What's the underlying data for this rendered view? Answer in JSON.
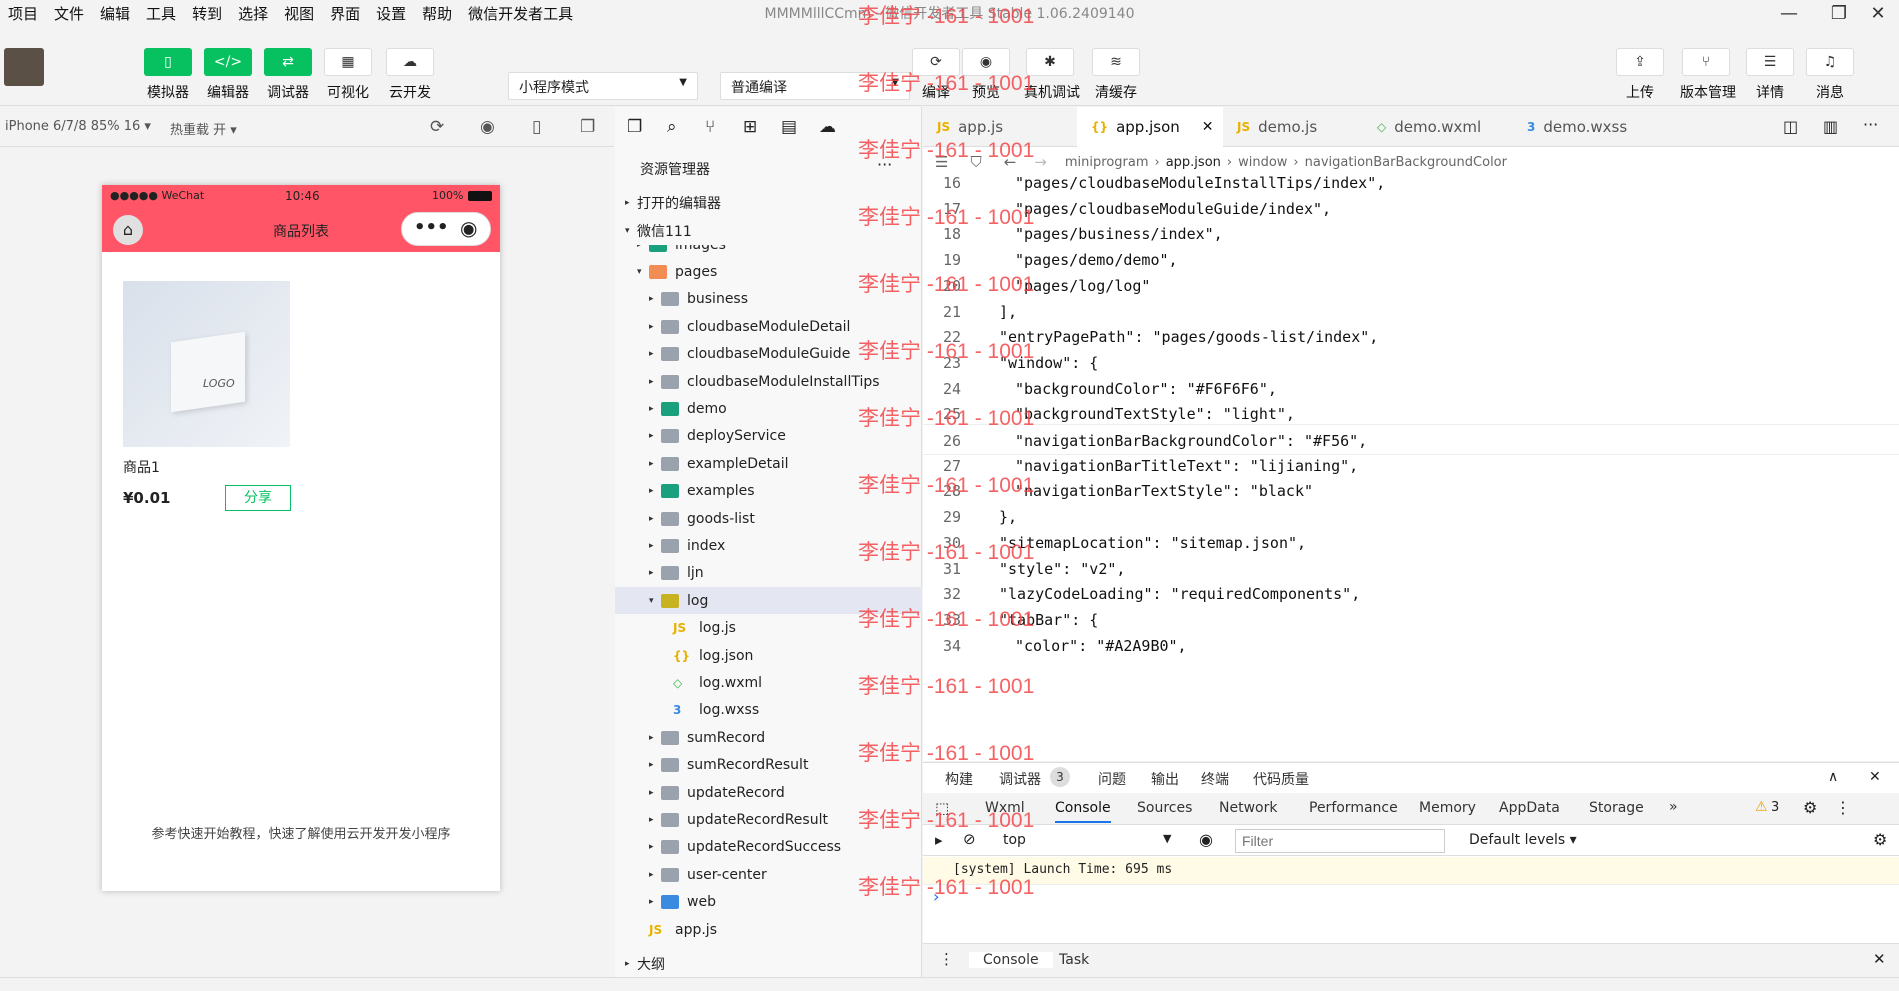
{
  "menu": [
    "项目",
    "文件",
    "编辑",
    "工具",
    "转到",
    "选择",
    "视图",
    "界面",
    "设置",
    "帮助",
    "微信开发者工具"
  ],
  "window_title": "MMMMlllCCmm - 微信开发者工具 Stable 1.06.2409140",
  "toolbar": {
    "left_buttons": [
      "模拟器",
      "编辑器",
      "调试器",
      "可视化",
      "云开发"
    ],
    "mode_select": "小程序模式",
    "compile_select": "普通编译",
    "mid_buttons": [
      "编译",
      "预览",
      "真机调试",
      "清缓存"
    ],
    "right_buttons": [
      "上传",
      "版本管理",
      "详情",
      "消息"
    ]
  },
  "watermark": "李佳宁 -161 - 1001",
  "simbar": {
    "device": "iPhone 6/7/8 85% 16 ▾",
    "hotreload": "热重载 开 ▾"
  },
  "phone": {
    "carrier": "●●●●● WeChat",
    "time": "10:46",
    "battery": "100%",
    "title": "商品列表",
    "product_name": "商品1",
    "price": "¥0.01",
    "share": "分享",
    "footer": "参考快速开始教程，快速了解使用云开发开发小程序",
    "logo_text": "LOGO"
  },
  "explorer": {
    "title": "资源管理器",
    "open_editors": "打开的编辑器",
    "project": "微信111",
    "items": [
      {
        "name": "images",
        "depth": 1,
        "kind": "teal",
        "arrow": "▸"
      },
      {
        "name": "pages",
        "depth": 1,
        "kind": "orange",
        "arrow": "▾"
      },
      {
        "name": "business",
        "depth": 2,
        "kind": "grey",
        "arrow": "▸"
      },
      {
        "name": "cloudbaseModuleDetail",
        "depth": 2,
        "kind": "grey",
        "arrow": "▸"
      },
      {
        "name": "cloudbaseModuleGuide",
        "depth": 2,
        "kind": "grey",
        "arrow": "▸"
      },
      {
        "name": "cloudbaseModuleInstallTips",
        "depth": 2,
        "kind": "grey",
        "arrow": "▸"
      },
      {
        "name": "demo",
        "depth": 2,
        "kind": "teal",
        "arrow": "▸"
      },
      {
        "name": "deployService",
        "depth": 2,
        "kind": "grey",
        "arrow": "▸"
      },
      {
        "name": "exampleDetail",
        "depth": 2,
        "kind": "grey",
        "arrow": "▸"
      },
      {
        "name": "examples",
        "depth": 2,
        "kind": "teal",
        "arrow": "▸"
      },
      {
        "name": "goods-list",
        "depth": 2,
        "kind": "grey",
        "arrow": "▸"
      },
      {
        "name": "index",
        "depth": 2,
        "kind": "grey",
        "arrow": "▸"
      },
      {
        "name": "ljn",
        "depth": 2,
        "kind": "grey",
        "arrow": "▸"
      },
      {
        "name": "log",
        "depth": 2,
        "kind": "lime",
        "arrow": "▾"
      },
      {
        "name": "log.js",
        "depth": 3,
        "kind": "js",
        "arrow": ""
      },
      {
        "name": "log.json",
        "depth": 3,
        "kind": "json",
        "arrow": ""
      },
      {
        "name": "log.wxml",
        "depth": 3,
        "kind": "wxml",
        "arrow": ""
      },
      {
        "name": "log.wxss",
        "depth": 3,
        "kind": "wxss",
        "arrow": ""
      },
      {
        "name": "sumRecord",
        "depth": 2,
        "kind": "grey",
        "arrow": "▸"
      },
      {
        "name": "sumRecordResult",
        "depth": 2,
        "kind": "grey",
        "arrow": "▸"
      },
      {
        "name": "updateRecord",
        "depth": 2,
        "kind": "grey",
        "arrow": "▸"
      },
      {
        "name": "updateRecordResult",
        "depth": 2,
        "kind": "grey",
        "arrow": "▸"
      },
      {
        "name": "updateRecordSuccess",
        "depth": 2,
        "kind": "grey",
        "arrow": "▸"
      },
      {
        "name": "user-center",
        "depth": 2,
        "kind": "grey",
        "arrow": "▸"
      },
      {
        "name": "web",
        "depth": 2,
        "kind": "blue",
        "arrow": "▸"
      },
      {
        "name": "app.js",
        "depth": 1,
        "kind": "js",
        "arrow": ""
      }
    ],
    "outline": "大纲"
  },
  "editor": {
    "tabs": [
      "app.js",
      "app.json",
      "demo.js",
      "demo.wxml",
      "demo.wxss"
    ],
    "active_tab": "app.json",
    "breadcrumb": [
      "miniprogram",
      "app.json",
      "window",
      "navigationBarBackgroundColor"
    ],
    "lines": [
      {
        "no": "16",
        "text": "\"pages/cloudbaseModuleInstallTips/index\","
      },
      {
        "no": "17",
        "text": "\"pages/cloudbaseModuleGuide/index\","
      },
      {
        "no": "18",
        "text": "\"pages/business/index\","
      },
      {
        "no": "19",
        "text": "\"pages/demo/demo\","
      },
      {
        "no": "20",
        "text": "\"pages/log/log\""
      },
      {
        "no": "21",
        "text": "],"
      },
      {
        "no": "22",
        "text": "\"entryPagePath\": \"pages/goods-list/index\","
      },
      {
        "no": "23",
        "text": "\"window\": {"
      },
      {
        "no": "24",
        "text": "\"backgroundColor\": \"#F6F6F6\","
      },
      {
        "no": "25",
        "text": "\"backgroundTextStyle\": \"light\","
      },
      {
        "no": "26",
        "text": "\"navigationBarBackgroundColor\": \"#F56\","
      },
      {
        "no": "27",
        "text": "\"navigationBarTitleText\": \"lijianing\","
      },
      {
        "no": "28",
        "text": "\"navigationBarTextStyle\": \"black\""
      },
      {
        "no": "29",
        "text": "},"
      },
      {
        "no": "30",
        "text": "\"sitemapLocation\": \"sitemap.json\","
      },
      {
        "no": "31",
        "text": "\"style\": \"v2\","
      },
      {
        "no": "32",
        "text": "\"lazyCodeLoading\": \"requiredComponents\","
      },
      {
        "no": "33",
        "text": "\"tabBar\": {"
      },
      {
        "no": "34",
        "text": "\"color\": \"#A2A9B0\","
      }
    ]
  },
  "panel": {
    "top_tabs": [
      "构建",
      "调试器",
      "问题",
      "输出",
      "终端",
      "代码质量"
    ],
    "debugger_badge": "3",
    "devtool_tabs": [
      "Wxml",
      "Console",
      "Sources",
      "Network",
      "Performance",
      "Memory",
      "AppData",
      "Storage"
    ],
    "more": "»",
    "warn_count": "3",
    "context": "top",
    "filter_placeholder": "Filter",
    "levels": "Default levels ▾",
    "log": "[system] Launch Time: 695 ms",
    "prompt": "›",
    "bottom_tabs": [
      "Console",
      "Task"
    ]
  }
}
